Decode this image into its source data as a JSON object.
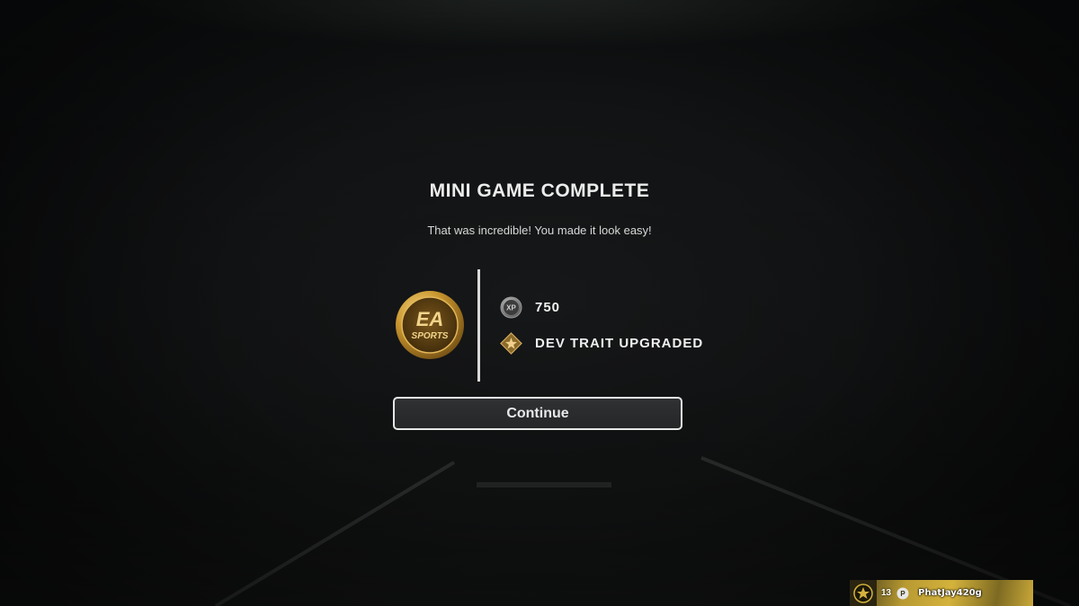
{
  "dialog": {
    "title": "MINI GAME COMPLETE",
    "message": "That was incredible! You made it look easy!",
    "coin_logo_text": "EA SPORTS",
    "rewards": [
      {
        "icon": "xp-icon",
        "text": "750"
      },
      {
        "icon": "dev-trait-icon",
        "text": "DEV TRAIT UPGRADED"
      }
    ],
    "continue_label": "Continue"
  },
  "player_card": {
    "level": "13",
    "platform_icon": "playstation-icon",
    "gamertag": "PhatJay420g"
  },
  "colors": {
    "background": "#0a0b0c",
    "coin_gold": "#c9962e",
    "button_border": "#e6e6e6",
    "gamertag_gold": "#d4b23c"
  }
}
